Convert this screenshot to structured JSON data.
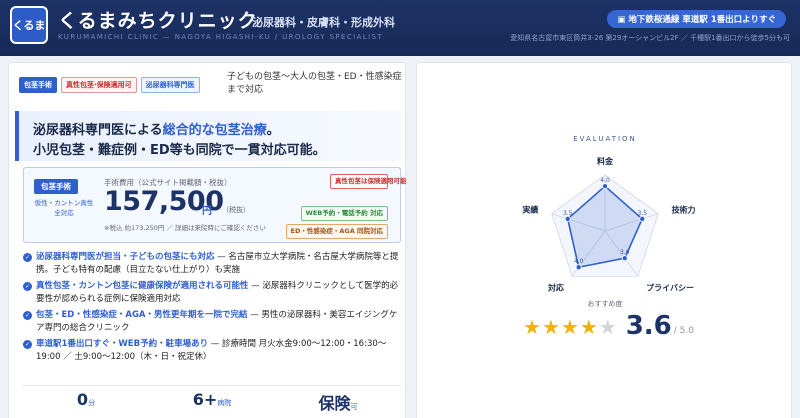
{
  "header": {
    "logo_text": "くるま",
    "clinic_name": "くるまみちクリニック",
    "clinic_tag": "泌尿器科・皮膚科・形成外科",
    "clinic_en": "KURUMAMICHI CLINIC — NAGOYA HIGASHI-KU / UROLOGY SPECIALIST",
    "access_pill": "地下鉄桜通線 車道駅 1番出口よりすぐ",
    "address": "愛知県名古屋市東区筒井3-26 第29オーシャンビル2F ／ 千種駅1番出口から徒歩5分も可"
  },
  "left": {
    "tags": [
      "包茎手術",
      "真性包茎·保険適用可",
      "泌尿器科専門医"
    ],
    "tag_desc": "子どもの包茎〜大人の包茎・ED・性感染症まで対応",
    "hero": {
      "line1_pre": "泌尿器科専門医による",
      "line1_hl": "総合的な包茎治療",
      "line1_post": "。",
      "line2": "小児包茎・難症例・ED等も同院で一貫対応可能。"
    },
    "price": {
      "badge": "包茎手術",
      "sub": "仮性・カントン真性 全対応",
      "label": "手術費用（公式サイト掲載額・税抜）",
      "amount": "157,500",
      "unit": "円",
      "tax": "（税抜）",
      "note": "※税込 約173,250円 ／ 詳細は来院時にご確認ください",
      "badge_red": "真性包茎は保険適用可能",
      "badge_green": "WEB予約・電話予約 対応",
      "badge_orange": "ED・性感染症・AGA 同院対応"
    },
    "bullets": [
      {
        "b": "泌尿器科専門医が担当・子どもの包茎にも対応",
        "t": " — 名古屋市立大学病院・名古屋大学病院等と提携。子ども特有の配慮（目立たない仕上がり）も実施"
      },
      {
        "b": "真性包茎・カントン包茎に健康保険が適用される可能性",
        "t": " — 泌尿器科クリニックとして医学的必要性が認められる症例に保険適用対応"
      },
      {
        "b": "包茎・ED・性感染症・AGA・男性更年期を一院で完結",
        "t": " — 男性の泌尿器科・美容エイジングケア専門の総合クリニック"
      },
      {
        "b": "車道駅1番出口すぐ・WEB予約・駐車場あり",
        "t": " — 診療時間 月火水金9:00〜12:00・16:30〜19:00 ／ 土9:00〜12:00（木・日・祝定休）"
      }
    ],
    "stats": [
      {
        "n": "0",
        "u": "分"
      },
      {
        "n": "6+",
        "u": "病院"
      },
      {
        "n": "保険",
        "u": "可"
      }
    ]
  },
  "right": {
    "eval_title": "EVALUATION",
    "axes": [
      {
        "label": "料金",
        "value": 4.0
      },
      {
        "label": "技術力",
        "value": 3.5
      },
      {
        "label": "プライバシー",
        "value": 3.0
      },
      {
        "label": "対応",
        "value": 4.0
      },
      {
        "label": "実績",
        "value": 3.5
      }
    ],
    "max": 5,
    "rec_label": "おすすめ度",
    "score": "3.6",
    "score_max": "/ 5.0",
    "stars_filled": 4,
    "stars_total": 5,
    "accent": "#2f5fcf"
  }
}
